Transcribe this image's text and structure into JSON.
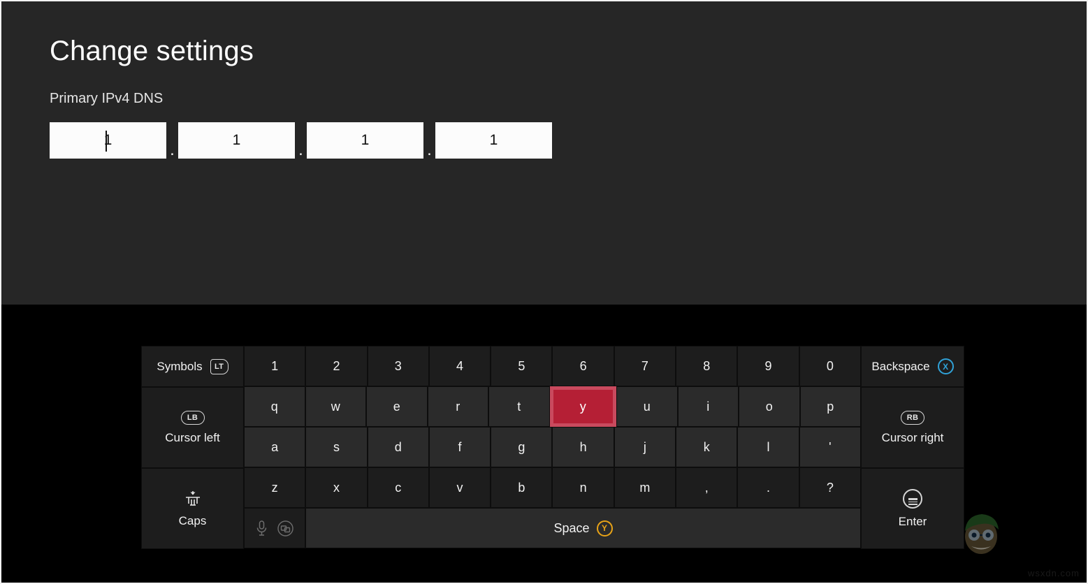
{
  "window": {
    "title": "Change settings",
    "panel_bg": "#262626",
    "keyboard_bg": "#000000"
  },
  "settings": {
    "heading": "Change settings",
    "field_label": "Primary IPv4 DNS",
    "octets": [
      {
        "value": "1",
        "focused": true
      },
      {
        "value": "1",
        "focused": false
      },
      {
        "value": "1",
        "focused": false
      },
      {
        "value": "1",
        "focused": false
      }
    ],
    "separator": "."
  },
  "keyboard": {
    "selected_key": "y",
    "selected_color": "#b51f35",
    "selected_border_color": "#c94a5e",
    "left_column": {
      "symbols": {
        "label": "Symbols",
        "badge": "LT",
        "icon": "trigger-lt-icon"
      },
      "cursor_left": {
        "label": "Cursor left",
        "badge": "LB",
        "icon": "bumper-lb-icon"
      },
      "caps": {
        "label": "Caps",
        "icon": "caps-lock-icon"
      }
    },
    "right_column": {
      "backspace": {
        "label": "Backspace",
        "badge": "X",
        "badge_color": "#30a2d8",
        "icon": "button-x-icon"
      },
      "cursor_right": {
        "label": "Cursor right",
        "badge": "RB",
        "icon": "bumper-rb-icon"
      },
      "enter": {
        "label": "Enter",
        "icon": "menu-button-icon"
      }
    },
    "rows": [
      [
        "1",
        "2",
        "3",
        "4",
        "5",
        "6",
        "7",
        "8",
        "9",
        "0"
      ],
      [
        "q",
        "w",
        "e",
        "r",
        "t",
        "y",
        "u",
        "i",
        "o",
        "p"
      ],
      [
        "a",
        "s",
        "d",
        "f",
        "g",
        "h",
        "j",
        "k",
        "l",
        "'"
      ],
      [
        "z",
        "x",
        "c",
        "v",
        "b",
        "n",
        "m",
        ",",
        ".",
        "?"
      ]
    ],
    "space_row": {
      "mic_icon": "microphone-icon",
      "duplicate_icon": "duplicate-screen-icon",
      "space": {
        "label": "Space",
        "badge": "Y",
        "badge_color": "#e8a317",
        "icon": "button-y-icon"
      }
    }
  },
  "watermarks": {
    "site": "wsxdn.com",
    "mascot": "cartoon-mascot-watermark"
  }
}
